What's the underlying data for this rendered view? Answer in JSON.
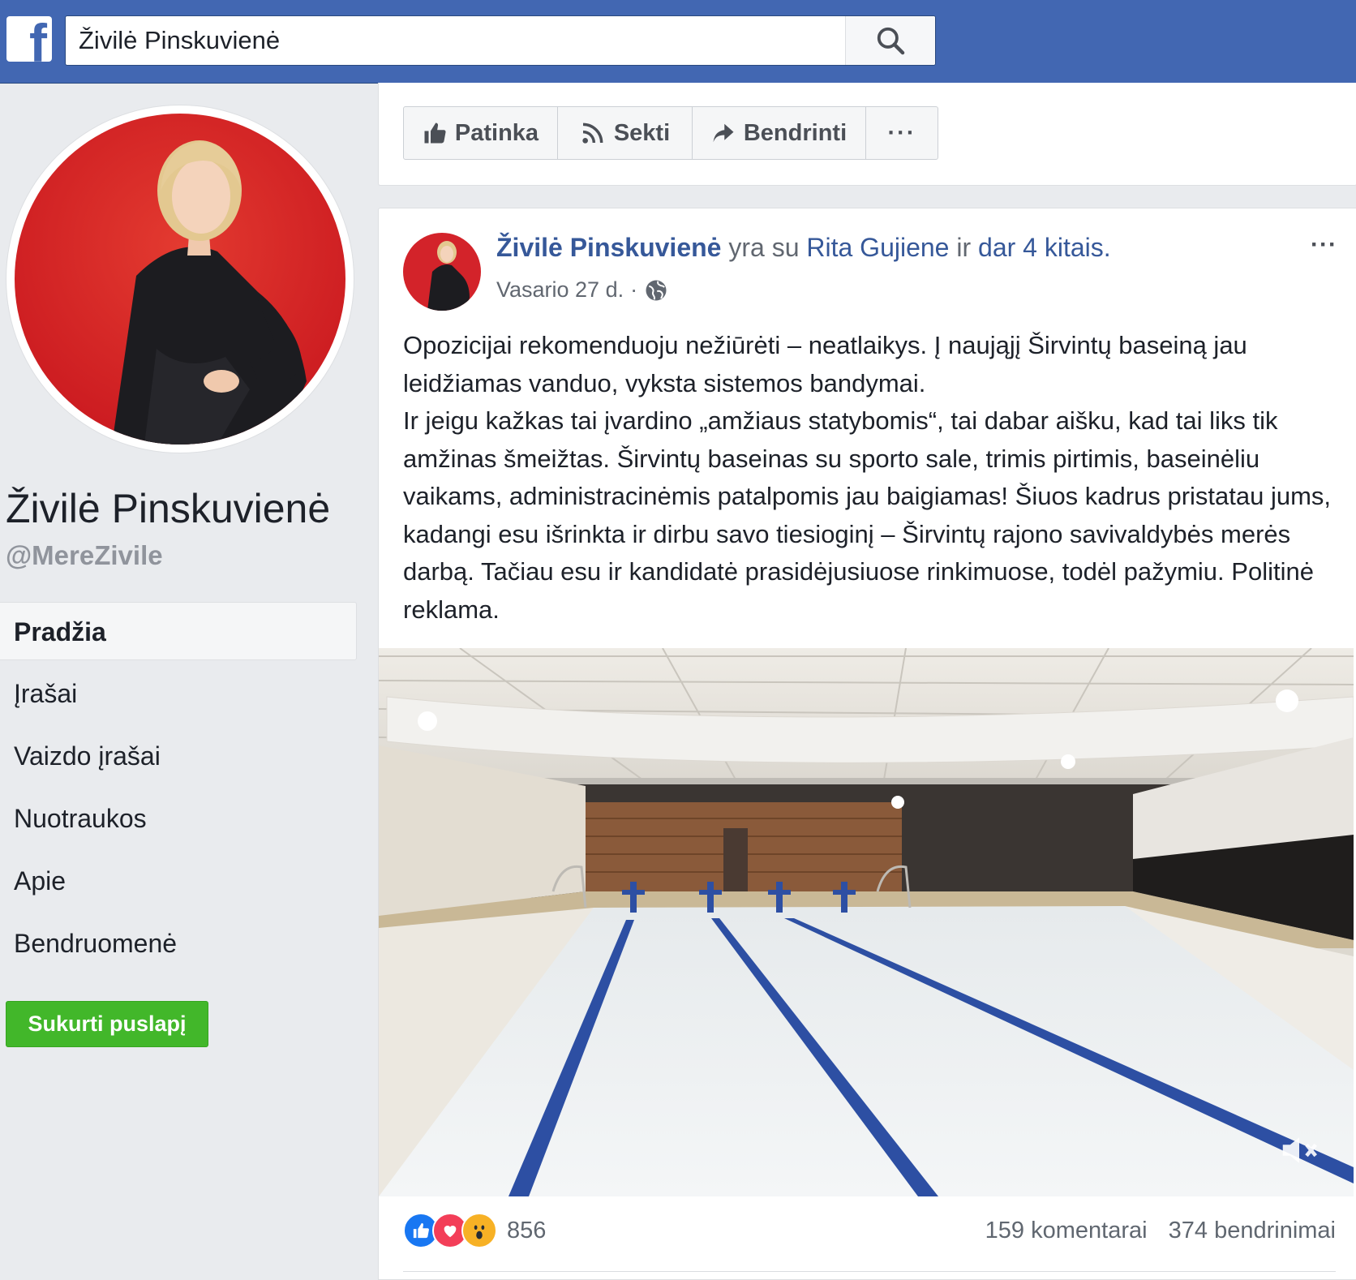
{
  "topbar": {
    "logo_icon": "facebook-f-logo",
    "search_value": "Živilė Pinskuvienė",
    "search_icon": "search-icon"
  },
  "profile": {
    "name": "Živilė Pinskuvienė",
    "handle": "@MereZivile"
  },
  "nav": {
    "items": [
      {
        "label": "Pradžia",
        "active": true
      },
      {
        "label": "Įrašai"
      },
      {
        "label": "Vaizdo įrašai"
      },
      {
        "label": "Nuotraukos"
      },
      {
        "label": "Apie"
      },
      {
        "label": "Bendruomenė"
      }
    ],
    "create_page_label": "Sukurti puslapį"
  },
  "actions": {
    "like_label": "Patinka",
    "follow_label": "Sekti",
    "share_label": "Bendrinti",
    "more_label": "···"
  },
  "post": {
    "author": "Živilė Pinskuvienė",
    "with_text": "yra su",
    "tagged": "Rita Gujiene",
    "and_text": "ir",
    "others": "dar 4 kitais",
    "period": ".",
    "date": "Vasario 27 d.",
    "meta_separator": "·",
    "privacy_icon": "globe-icon",
    "more_label": "···",
    "paragraph_1": "Opozicijai rekomenduoju nežiūrėti – neatlaikys. Į naująjį Širvintų baseiną jau leidžiamas vanduo, vyksta sistemos bandymai.",
    "paragraph_2": "Ir jeigu kažkas tai įvardino „amžiaus statybomis“, tai dabar aišku, kad tai liks tik amžinas šmeižtas. Širvintų baseinas su sporto sale, trimis pirtimis, baseinėliu vaikams, administracinėmis patalpomis jau baigiamas! Šiuos kadrus pristatau jums, kadangi esu išrinkta ir dirbu savo tiesioginį – Širvintų rajono savivaldybės merės darbą. Tačiau esu ir kandidatė prasidėjusiuose rinkimuose, todėl pažymiu. Politinė reklama.",
    "mute_icon": "muted-speaker-icon"
  },
  "engagement": {
    "reaction_icons": [
      "like-reaction-icon",
      "love-reaction-icon",
      "wow-reaction-icon"
    ],
    "reaction_count": "856",
    "comments": "159 komentarai",
    "shares": "374 bendrinimai"
  },
  "colors": {
    "brand_blue": "#4267b2",
    "link_blue": "#365899",
    "green_button": "#42b72a",
    "profile_red": "#d8232a"
  }
}
